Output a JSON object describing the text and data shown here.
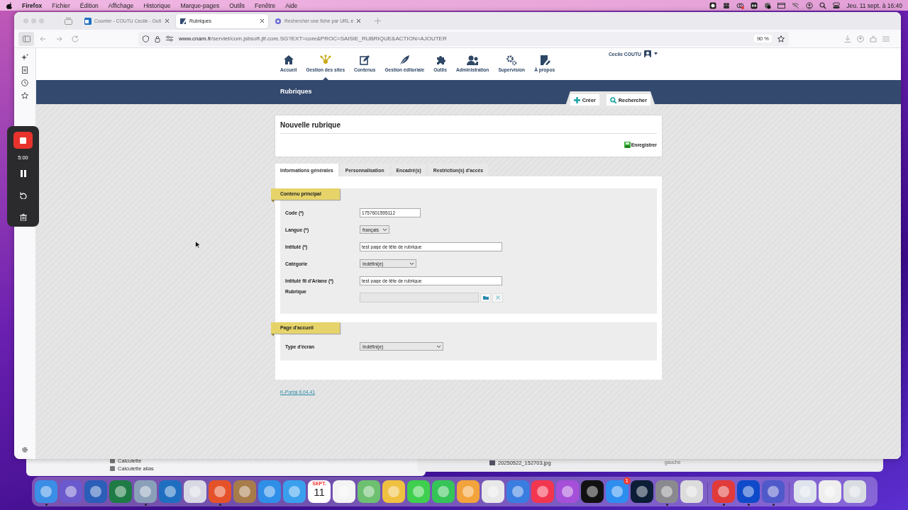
{
  "menubar": {
    "app": "Firefox",
    "menus": [
      "Fichier",
      "Édition",
      "Affichage",
      "Historique",
      "Marque-pages",
      "Outils",
      "Fenêtre",
      "Aide"
    ],
    "clock": "Jeu. 11 sept. à  16:40"
  },
  "browser": {
    "tabs": [
      {
        "title": "Courrier - COUTU Cecile - Outl",
        "selected": false
      },
      {
        "title": "Rubriques",
        "selected": true
      },
      {
        "title": "Rechercher une fiche par URL e",
        "selected": false
      }
    ],
    "url_host": "www.cnam.fr",
    "url_path": "/servlet/com.jsbsoft.jtf.core.SG?EXT=core&PROC=SAISIE_RUBRIQUE&ACTION=AJOUTER",
    "zoom": "90 %"
  },
  "site": {
    "nav": [
      {
        "label": "Accueil",
        "selected": false
      },
      {
        "label": "Gestion des sites",
        "selected": true
      },
      {
        "label": "Contenus",
        "selected": false
      },
      {
        "label": "Gestion éditoriale",
        "selected": false
      },
      {
        "label": "Outils",
        "selected": false
      },
      {
        "label": "Administration",
        "selected": false
      },
      {
        "label": "Supervision",
        "selected": false
      },
      {
        "label": "À propos",
        "selected": false
      }
    ],
    "user": "Cecile COUTU",
    "banner_title": "Rubriques",
    "actions": [
      "Créer",
      "Rechercher"
    ]
  },
  "form": {
    "title": "Nouvelle rubrique",
    "save": "Enregistrer",
    "tabs": [
      {
        "label": "Informations générales",
        "selected": true
      },
      {
        "label": "Personnalisation",
        "selected": false
      },
      {
        "label": "Encadré(s)",
        "selected": false
      },
      {
        "label": "Restriction(s) d'accès",
        "selected": false
      }
    ],
    "sections": [
      {
        "title": "Contenu principal",
        "fields": [
          {
            "label": "Code (*)",
            "kind": "text",
            "value": "1757601595112"
          },
          {
            "label": "Langue (*)",
            "kind": "select",
            "value": "français"
          },
          {
            "label": "Intitulé (*)",
            "kind": "text",
            "value": "test page de tête de rubrique"
          },
          {
            "label": "Catégorie",
            "kind": "select",
            "value": "Indéfini(e)"
          },
          {
            "label": "Intitulé fil d'Ariane (*)",
            "kind": "text",
            "value": "test page de tête de rubrique"
          },
          {
            "label": "Rubrique",
            "kind": "picker"
          }
        ]
      },
      {
        "title": "Page d'accueil",
        "fields": [
          {
            "label": "Type d'écran",
            "kind": "select",
            "value": "Indéfini(e)"
          }
        ]
      }
    ],
    "footer_link": "K-Portal 6.04.41"
  },
  "recorder": {
    "time": "5:00"
  },
  "background_windows": {
    "left_items": [
      "Calculette",
      "Calculette alias"
    ],
    "right_items": [
      "20250522_152703.jpg"
    ],
    "right_column": "gauche"
  },
  "dock": {
    "apps": [
      {
        "kind": "app",
        "color": "#3a8ee6",
        "running": true
      },
      {
        "kind": "app",
        "color": "#6a5acd",
        "running": false
      },
      {
        "kind": "app",
        "color": "#2b5eb8",
        "running": false
      },
      {
        "kind": "app",
        "color": "#1e7b45",
        "running": false
      },
      {
        "kind": "app",
        "color": "#8aa0b8",
        "running": true
      },
      {
        "kind": "app",
        "color": "#1f6fc1",
        "running": false
      },
      {
        "kind": "app",
        "color": "#d8d8e4",
        "running": false
      },
      {
        "kind": "app",
        "color": "#e5522a",
        "running": true
      },
      {
        "kind": "app",
        "color": "#a87c4a",
        "running": false
      },
      {
        "kind": "app",
        "color": "#2f8fe8",
        "running": false
      },
      {
        "kind": "app",
        "color": "#3aa0ee",
        "running": false
      },
      {
        "kind": "calendar",
        "month": "SEPT.",
        "day": "11",
        "running": false
      },
      {
        "kind": "app",
        "color": "#f4f4f4",
        "running": false
      },
      {
        "kind": "app",
        "color": "#6cc070",
        "running": false
      },
      {
        "kind": "app",
        "color": "#f0c040",
        "running": false
      },
      {
        "kind": "app",
        "color": "#3ecf4e",
        "running": false
      },
      {
        "kind": "app",
        "color": "#35c457",
        "running": false
      },
      {
        "kind": "app",
        "color": "#f2a33b",
        "running": false
      },
      {
        "kind": "app",
        "color": "#e8e8e8",
        "running": false
      },
      {
        "kind": "app",
        "color": "#3a7de0",
        "running": false
      },
      {
        "kind": "app",
        "color": "#f2364f",
        "running": false
      },
      {
        "kind": "app",
        "color": "#a64fd8",
        "running": false
      },
      {
        "kind": "app",
        "color": "#111111",
        "running": false
      },
      {
        "kind": "app",
        "color": "#2d8ef0",
        "running": false,
        "badge": "1"
      },
      {
        "kind": "app",
        "color": "#0c1d36",
        "running": false
      },
      {
        "kind": "app",
        "color": "#8a8a8e",
        "running": true
      },
      {
        "kind": "app",
        "color": "#dcdcdc",
        "running": false
      },
      {
        "kind": "divider"
      },
      {
        "kind": "app",
        "color": "#e03a3a",
        "running": true
      },
      {
        "kind": "app",
        "color": "#0e4ac9",
        "running": true
      },
      {
        "kind": "app",
        "color": "#5059c9",
        "running": true
      },
      {
        "kind": "divider"
      },
      {
        "kind": "app",
        "color": "#dfe4ec",
        "running": false
      },
      {
        "kind": "app",
        "color": "#eeeeee",
        "running": false
      },
      {
        "kind": "app",
        "color": "#d9dde2",
        "running": false
      }
    ]
  }
}
